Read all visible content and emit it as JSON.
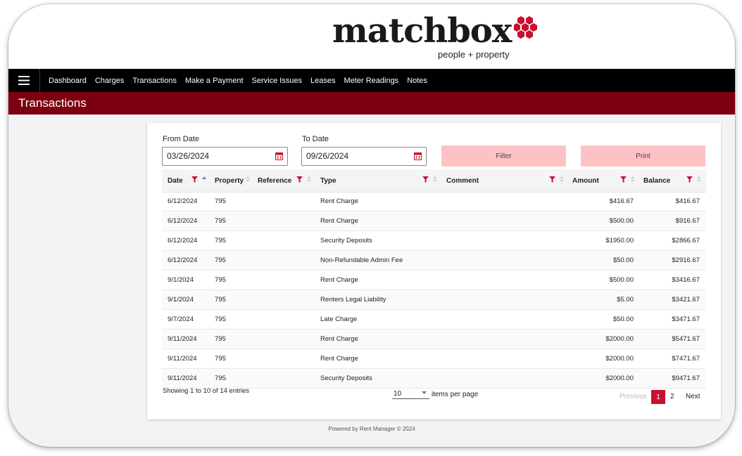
{
  "brand": {
    "name": "matchbox",
    "tagline": "people + property",
    "accent_color": "#c8102e"
  },
  "nav": {
    "menu_icon": "hamburger-menu-icon",
    "items": [
      "Dashboard",
      "Charges",
      "Transactions",
      "Make a Payment",
      "Service Issues",
      "Leases",
      "Meter Readings",
      "Notes"
    ]
  },
  "page": {
    "title": "Transactions",
    "banner_color": "#7d0010"
  },
  "filters": {
    "from_label": "From Date",
    "from_value": "03/26/2024",
    "to_label": "To Date",
    "to_value": "09/26/2024",
    "calendar_icon": "calendar-icon",
    "filter_button": "Filter",
    "print_button": "Print",
    "button_color": "#ffc2c4"
  },
  "table": {
    "columns": {
      "date": "Date",
      "property": "Property",
      "reference": "Reference",
      "type": "Type",
      "comment": "Comment",
      "amount": "Amount",
      "balance": "Balance"
    },
    "rows": [
      {
        "date": "6/12/2024",
        "property": "795",
        "reference": "",
        "type": "Rent Charge",
        "comment": "",
        "amount": "$416.67",
        "balance": "$416.67"
      },
      {
        "date": "6/12/2024",
        "property": "795",
        "reference": "",
        "type": "Rent Charge",
        "comment": "",
        "amount": "$500.00",
        "balance": "$916.67"
      },
      {
        "date": "6/12/2024",
        "property": "795",
        "reference": "",
        "type": "Security Deposits",
        "comment": "",
        "amount": "$1950.00",
        "balance": "$2866.67"
      },
      {
        "date": "6/12/2024",
        "property": "795",
        "reference": "",
        "type": "Non-Refundable Admin Fee",
        "comment": "",
        "amount": "$50.00",
        "balance": "$2916.67"
      },
      {
        "date": "9/1/2024",
        "property": "795",
        "reference": "",
        "type": "Rent Charge",
        "comment": "",
        "amount": "$500.00",
        "balance": "$3416.67"
      },
      {
        "date": "9/1/2024",
        "property": "795",
        "reference": "",
        "type": "Renters Legal Liability",
        "comment": "",
        "amount": "$5.00",
        "balance": "$3421.67"
      },
      {
        "date": "9/7/2024",
        "property": "795",
        "reference": "",
        "type": "Late Charge",
        "comment": "",
        "amount": "$50.00",
        "balance": "$3471.67"
      },
      {
        "date": "9/11/2024",
        "property": "795",
        "reference": "",
        "type": "Rent Charge",
        "comment": "",
        "amount": "$2000.00",
        "balance": "$5471.67"
      },
      {
        "date": "9/11/2024",
        "property": "795",
        "reference": "",
        "type": "Rent Charge",
        "comment": "",
        "amount": "$2000.00",
        "balance": "$7471.67"
      },
      {
        "date": "9/11/2024",
        "property": "795",
        "reference": "",
        "type": "Security Deposits",
        "comment": "",
        "amount": "$2000.00",
        "balance": "$9471.67"
      }
    ]
  },
  "pagination": {
    "showing": "Showing 1 to 10 of 14 entries",
    "page_size": "10",
    "per_page_label": "items per page",
    "previous": "Previous",
    "pages": [
      "1",
      "2"
    ],
    "next": "Next"
  },
  "footer": {
    "text": "Powered by Rent Manager © 2024"
  }
}
